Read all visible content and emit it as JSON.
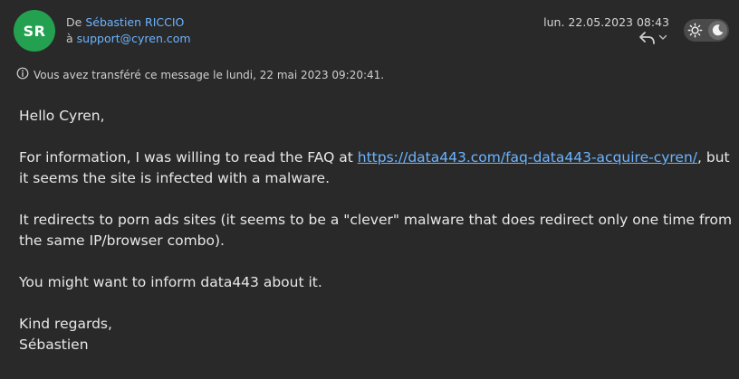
{
  "header": {
    "avatar_initials": "SR",
    "from_prefix": "De",
    "from_name": "Sébastien RICCIO",
    "to_prefix": "à",
    "to_address": "support@cyren.com",
    "date": "lun. 22.05.2023 08:43",
    "reply_icon": "reply-arrow-icon",
    "dropdown_icon": "chevron-down-icon",
    "theme_icons": [
      "sun-icon",
      "moon-icon"
    ]
  },
  "forward_note": {
    "icon": "info-icon",
    "text": "Vous avez transféré ce message le lundi, 22 mai 2023 09:20:41."
  },
  "message": {
    "greeting": "Hello Cyren,",
    "p1_before": "For information, I was willing to read the FAQ at ",
    "p1_link": "https://data443.com/faq-data443-acquire-cyren/",
    "p1_after": ", but it seems the site is infected with a malware.",
    "p2": "It redirects to porn ads sites (it seems to be a \"clever\" malware that does redirect only one time from the same IP/browser combo).",
    "p3": "You might want to inform data443 about it.",
    "closing": "Kind regards,",
    "signature": "Sébastien"
  },
  "colors": {
    "background": "#292929",
    "avatar": "#24a150",
    "link": "#6cb4ff",
    "text": "#e8e8e8"
  }
}
